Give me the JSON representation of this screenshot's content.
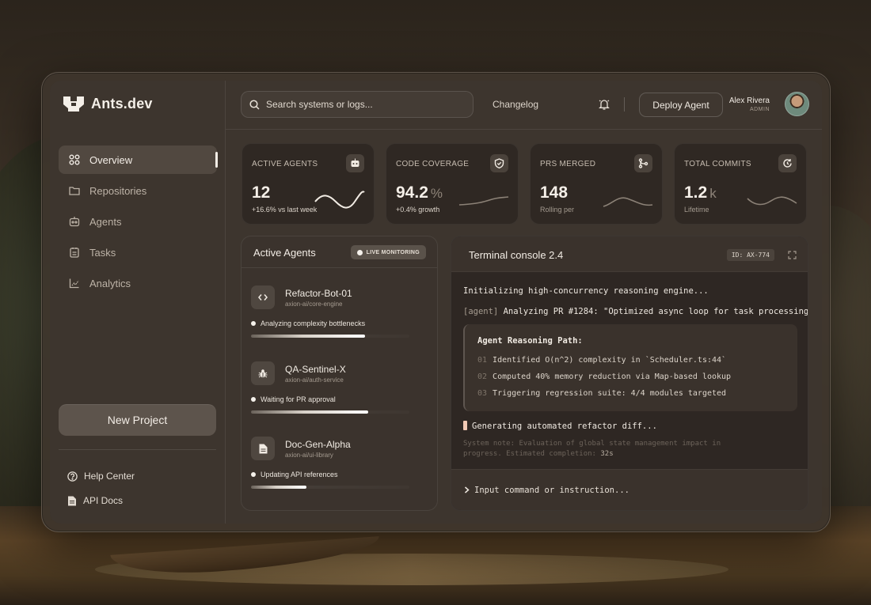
{
  "brand": {
    "name": "Ants.dev"
  },
  "nav": {
    "items": [
      {
        "label": "Overview",
        "icon": "grid-icon",
        "active": true
      },
      {
        "label": "Repositories",
        "icon": "folder-icon",
        "active": false
      },
      {
        "label": "Agents",
        "icon": "robot-icon",
        "active": false
      },
      {
        "label": "Tasks",
        "icon": "clipboard-icon",
        "active": false
      },
      {
        "label": "Analytics",
        "icon": "chart-icon",
        "active": false
      }
    ],
    "new_project": "New Project",
    "footer": [
      {
        "label": "Help Center",
        "icon": "help-icon"
      },
      {
        "label": "API Docs",
        "icon": "document-icon"
      }
    ]
  },
  "header": {
    "search_placeholder": "Search systems or logs...",
    "changelog": "Changelog",
    "deploy": "Deploy Agent",
    "user": {
      "name": "Alex Rivera",
      "role": "ADMIN"
    }
  },
  "stats": [
    {
      "label": "ACTIVE AGENTS",
      "value": "12",
      "unit": "",
      "sub": "+16.6% vs last week",
      "icon": "robot-icon"
    },
    {
      "label": "CODE COVERAGE",
      "value": "94.2",
      "unit": "%",
      "sub": "+0.4% growth",
      "icon": "shield-check-icon"
    },
    {
      "label": "PRS MERGED",
      "value": "148",
      "unit": "",
      "sub": "Rolling per",
      "icon": "git-merge-icon"
    },
    {
      "label": "TOTAL COMMITS",
      "value": "1.2",
      "unit": "k",
      "sub": "Lifetime",
      "icon": "history-icon"
    }
  ],
  "agents_panel": {
    "title": "Active Agents",
    "badge": "LIVE MONITORING",
    "agents": [
      {
        "name": "Refactor-Bot-01",
        "repo": "axion-ai/core-engine",
        "status": "Analyzing complexity bottlenecks",
        "progress": 0.72,
        "icon": "code-icon"
      },
      {
        "name": "QA-Sentinel-X",
        "repo": "axion-ai/auth-service",
        "status": "Waiting for PR approval",
        "progress": 0.74,
        "icon": "bug-icon"
      },
      {
        "name": "Doc-Gen-Alpha",
        "repo": "axion-ai/ui-library",
        "status": "Updating API references",
        "progress": 0.35,
        "icon": "document-icon"
      }
    ]
  },
  "terminal": {
    "title": "Terminal console 2.4",
    "id": "ID: AX-774",
    "line1": "Initializing high-concurrency reasoning engine...",
    "line2_tag": "[agent]",
    "line2_text": "Analyzing PR #1284: \"Optimized async loop for task processing\"",
    "reasoning_title": "Agent Reasoning Path:",
    "steps": [
      {
        "num": "01",
        "text": "Identified O(n^2) complexity in `Scheduler.ts:44`"
      },
      {
        "num": "02",
        "text": "Computed 40% memory reduction via Map-based lookup"
      },
      {
        "num": "03",
        "text": "Triggering regression suite: 4/4 modules targeted"
      }
    ],
    "generating": "Generating automated refactor diff...",
    "system_note": "System note: Evaluation of global state management impact in progress. Estimated completion: ",
    "system_note_time": "32s",
    "input_placeholder": "Input command or instruction..."
  }
}
